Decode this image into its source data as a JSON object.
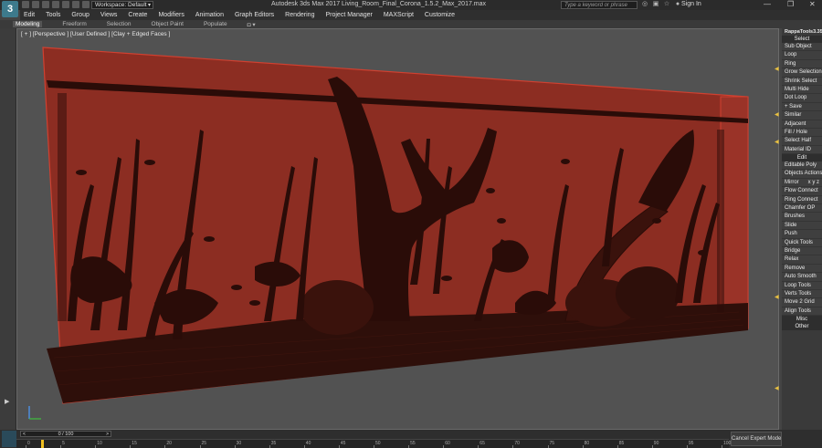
{
  "titlebar": {
    "logo": "3",
    "workspace": "Workspace: Default",
    "app_title": "Autodesk 3ds Max 2017      Living_Room_Final_Corona_1.5.2_Max_2017.max",
    "search_placeholder": "Type a keyword or phrase",
    "sign_in": "Sign In"
  },
  "menu": [
    "Edit",
    "Tools",
    "Group",
    "Views",
    "Create",
    "Modifiers",
    "Animation",
    "Graph Editors",
    "Rendering",
    "Project Manager",
    "MAXScript",
    "Customize"
  ],
  "ribbon_tabs": [
    "Modeling",
    "Freeform",
    "Selection",
    "Object Paint",
    "Populate"
  ],
  "viewport": {
    "label": "[ + ] [Perspective ] [User Defined ] [Clay + Edged Faces ]"
  },
  "right_panel": {
    "title": "RappaTools3.35",
    "sections": [
      {
        "header": "Select",
        "buttons": [
          "Sub Object",
          "Loop",
          "Ring",
          "Grow Selection",
          "Shrink Select",
          "Multi Hide",
          "Dot Loop",
          "+ Save",
          "Similar",
          "Adjacent",
          "Fill / Hole",
          "Select Half",
          "Material ID"
        ]
      },
      {
        "header": "Edit",
        "buttons": [
          "Editable Poly",
          "Objects Actions",
          "Mirror",
          "Flow Connect",
          "Ring Connect",
          "Chamfer OP",
          "Brushes",
          "Slide",
          "Push",
          "Quick Tools",
          "Bridge",
          "Relax",
          "Remove",
          "Auto Smooth",
          "Loop Tools",
          "Verts Tools",
          "Move 2 Grid",
          "Align Tools"
        ]
      },
      {
        "header": "Misc",
        "buttons": [
          "Other"
        ]
      }
    ],
    "mirror_axes": "x  y  z"
  },
  "timeline": {
    "frame_counter": "0 / 100",
    "ticks": [
      "0",
      "5",
      "10",
      "15",
      "20",
      "25",
      "30",
      "35",
      "40",
      "45",
      "50",
      "55",
      "60",
      "65",
      "70",
      "75",
      "80",
      "85",
      "90",
      "95",
      "100"
    ]
  },
  "bottom": {
    "cancel_expert": "Cancel Expert Mode"
  },
  "colors": {
    "tank_fill": "#8c2d22",
    "tank_edge": "#d04030",
    "wire": "#2a0c08",
    "accent": "#f0c020"
  }
}
